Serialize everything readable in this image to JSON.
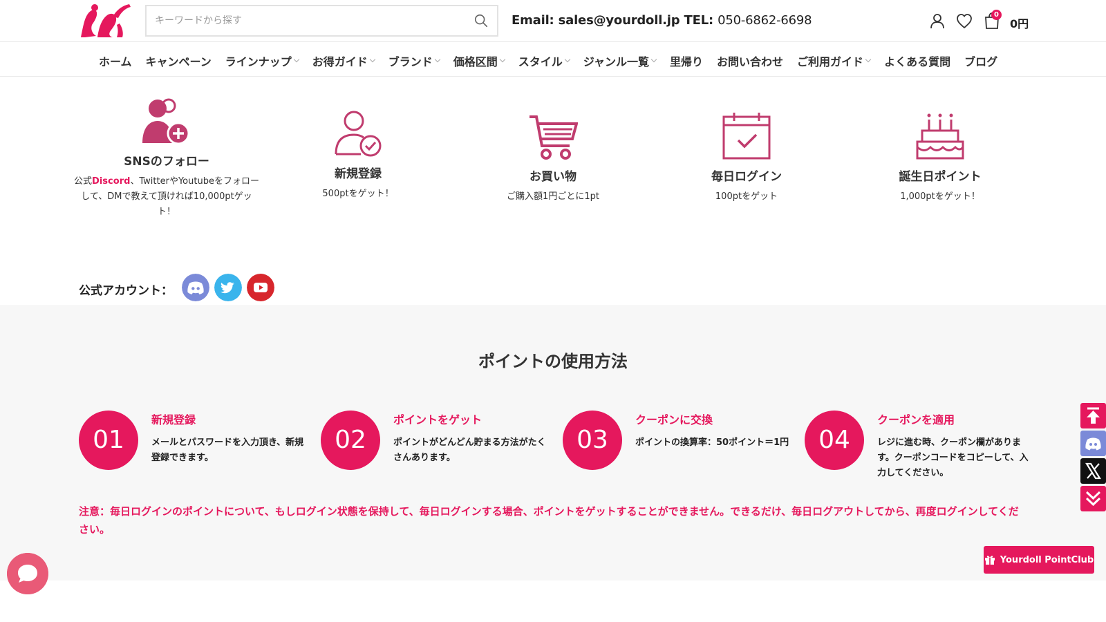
{
  "header": {
    "search_placeholder": "キーワードから探す",
    "email_label": "Email:",
    "email": "sales@yourdoll.jp",
    "tel_label": "TEL:",
    "tel": "050-6862-6698",
    "cart_count": "0",
    "cart_total": "0円"
  },
  "nav": {
    "items": [
      {
        "label": "ホーム",
        "dropdown": false
      },
      {
        "label": "キャンペーン",
        "dropdown": false
      },
      {
        "label": "ラインナップ",
        "dropdown": true
      },
      {
        "label": "お得ガイド",
        "dropdown": true
      },
      {
        "label": "ブランド",
        "dropdown": true
      },
      {
        "label": "価格区間",
        "dropdown": true
      },
      {
        "label": "スタイル",
        "dropdown": true
      },
      {
        "label": "ジャンル一覧",
        "dropdown": true
      },
      {
        "label": "里帰り",
        "dropdown": false
      },
      {
        "label": "お問い合わせ",
        "dropdown": false
      },
      {
        "label": "ご利用ガイド",
        "dropdown": true
      },
      {
        "label": "よくある質問",
        "dropdown": false
      },
      {
        "label": "ブログ",
        "dropdown": false
      }
    ]
  },
  "features": [
    {
      "icon": "user-add-icon",
      "title": "SNSのフォロー",
      "desc_pre": "公式",
      "desc_highlight": "Discord",
      "desc_post": "、TwitterやYoutubeをフォローして、DMで教えて頂ければ10,000ptゲット！"
    },
    {
      "icon": "user-check-icon",
      "title": "新規登録",
      "desc": "500ptをゲット！"
    },
    {
      "icon": "cart-icon",
      "title": "お買い物",
      "desc": "ご購入額1円ごとに1pt"
    },
    {
      "icon": "calendar-check-icon",
      "title": "毎日ログイン",
      "desc": "100ptをゲット"
    },
    {
      "icon": "birthday-cake-icon",
      "title": "誕生日ポイント",
      "desc": "1,000ptをゲット！"
    }
  ],
  "accounts": {
    "label": "公式アカウント：",
    "items": [
      {
        "icon": "discord-icon",
        "color": "#7b8ad8"
      },
      {
        "icon": "twitter-icon",
        "color": "#3ab4ec"
      },
      {
        "icon": "youtube-icon",
        "color": "#d7262c"
      }
    ]
  },
  "howto": {
    "title": "ポイントの使用方法",
    "steps": [
      {
        "num": "01",
        "title": "新規登録",
        "desc": "メールとパスワードを入力頂き、新規登録できます。"
      },
      {
        "num": "02",
        "title": "ポイントをゲット",
        "desc": "ポイントがどんどん貯まる方法がたくさんあります。"
      },
      {
        "num": "03",
        "title": "クーポンに交換",
        "desc": "ポイントの換算率：50ポイント＝1円"
      },
      {
        "num": "04",
        "title": "クーポンを適用",
        "desc": "レジに進む時、クーポン欄があります。クーポンコードをコピーして、入力してください。"
      }
    ],
    "note": "注意：毎日ログインのポイントについて、もしログイン状態を保持して、毎日ログインする場合、ポイントをゲットすることができません。できるだけ、毎日ログアウトしてから、再度ログインしてください。"
  },
  "floating": {
    "point_club_label": "Yourdoll PointClub"
  },
  "colors": {
    "brand": "#e5185d",
    "feature_icon": "#c03c6e"
  }
}
